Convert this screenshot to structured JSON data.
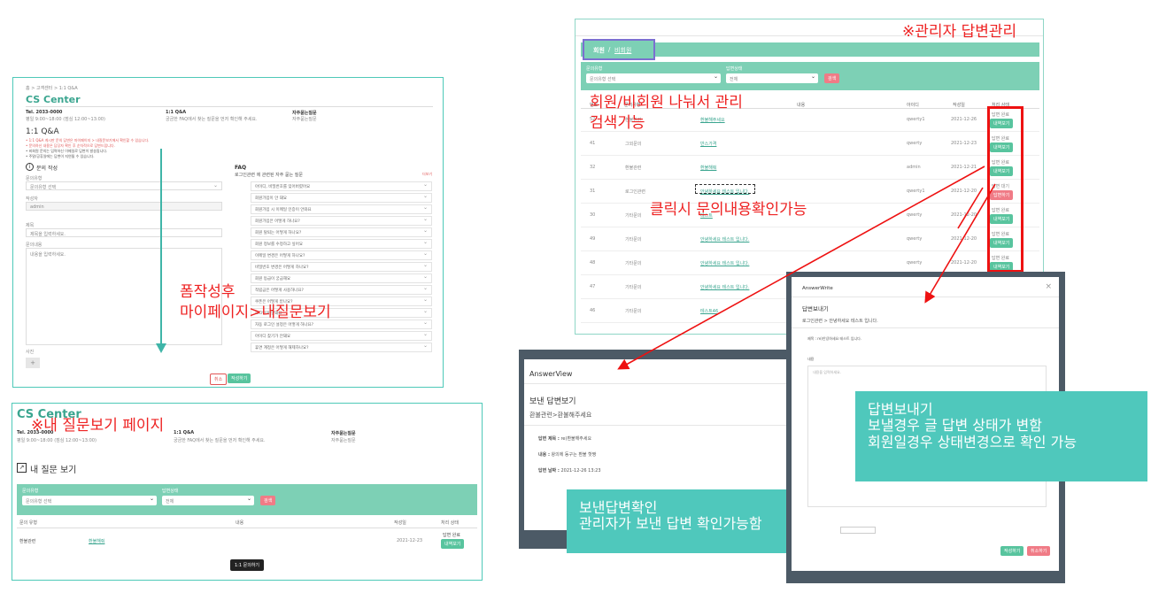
{
  "annotations": {
    "form_back": "폼작성후",
    "form_nav": "마이페이지>내질문보기",
    "my_questions": "※내 질문보기 페이지",
    "admin": "※관리자 답변관리",
    "split_members": "회원/비회원 나눠서 관리",
    "search": "검색기능",
    "click_view": "클릭시 문의내용확인가능",
    "view_box_1": "보낸답변확인",
    "view_box_2": "관리자가 보낸 답변 확인가능함",
    "send_box_1": "답변보내기",
    "send_box_2": "보낼경우 글  답변 상태가 변함",
    "send_box_3": "회원일경우 상태변경으로 확인 가능"
  },
  "qa_form": {
    "breadcrumb": "홈 > 고객센터 > 1:1 Q&A",
    "title": "CS Center",
    "tel": "Tel. 2033-0000",
    "hours": "평일 9:00~18:00 (점심 12:00~13:00)",
    "qna_label": "1:1 Q&A",
    "qna_desc": "궁금한 FAQ에서 찾는 질문을 먼저 확인해 주세요.",
    "faq_label": "자주묻는질문",
    "faq_desc": "자주묻는질문",
    "heading": "1:1 Q&A",
    "notices": [
      "• 1:1 Q&A 게시판 문의 답변은 마이페이지 > 내질문보기에서 확인할 수 있습니다.",
      "• 문의하신 내용은 담당자 확인 후 순차적으로 답변드립니다.",
      "• 비회원 문의는 입력하신 이메일로 답변이 발송됩니다.",
      "• 주말/공휴일에는 답변이 지연될 수 있습니다."
    ],
    "section": "문의 작성",
    "type_label": "문의유형",
    "type_value": "문의유형 선택",
    "writer_label": "작성자",
    "writer_value": "admin",
    "title_label": "제목",
    "title_placeholder": "제목을 입력하세요.",
    "content_label": "문의내용",
    "content_placeholder": "내용을 입력하세요.",
    "attach_label": "사진",
    "cancel": "취소",
    "submit": "작성하기",
    "faq_title": "FAQ",
    "faq_sub": "로그인관련 에 관련된 자주 묻는 질문",
    "faq_more": "더보기",
    "faq_items": [
      "아이디, 비밀번호를 잊어버렸어요",
      "회원가입이 안 돼요",
      "회원가입 시 이메일 인증이 안와요",
      "회원가입은 어떻게 하나요?",
      "회원 탈퇴는 어떻게 하나요?",
      "회원 정보를 수정하고 싶어요",
      "이메일 변경은 어떻게 하나요?",
      "비밀번호 변경은 어떻게 하나요?",
      "회원 등급이 궁금해요",
      "적립금은 어떻게 사용하나요?",
      "쿠폰은 어떻게 받나요?",
      "로그인이 안돼요",
      "자동 로그인 설정은 어떻게 하나요?",
      "아이디 찾기가 안돼요",
      "휴면 계정은 어떻게 해제하나요?"
    ]
  },
  "my_q": {
    "title": "CS Center",
    "tel": "Tel. 2033-0000",
    "hours": "평일 9:00~18:00 (점심 12:00~13:00)",
    "qna_label": "1:1 Q&A",
    "qna_desc": "궁금한 FAQ에서 찾는 질문을 먼저 확인해 주세요.",
    "faq_label": "자주묻는질문",
    "faq_desc": "자주묻는질문",
    "heading": "내 질문 보기",
    "filter_type_label": "문의유형",
    "filter_type_value": "문의유형 선택",
    "filter_status_label": "답변상태",
    "filter_status_value": "전체",
    "search": "검색",
    "cols": [
      "문의 유형",
      "내용",
      "작성일",
      "처리 상태"
    ],
    "row": {
      "type": "환불관련",
      "content": "환불해줘",
      "date": "2021-12-23",
      "status": "답변 완료",
      "btn": "내역보기"
    },
    "write_btn": "1:1 문의하기"
  },
  "admin": {
    "tabs_member": "회원",
    "tabs_sep": "/",
    "tabs_guest": "비회원",
    "filter_type_label": "문의유형",
    "filter_type_value": "문의유형 선택",
    "filter_status_label": "답변상태",
    "filter_status_value": "전체",
    "search": "검색",
    "cols": [
      "번호",
      "문의유형",
      "내용",
      "아이디",
      "작성일",
      "처리 상태"
    ],
    "rows": [
      {
        "no": "52",
        "type": "환불관련",
        "content": "환불해주세요",
        "id": "qwerty1",
        "date": "2021-12-26",
        "status": "답변 완료",
        "btn": "내역보기",
        "state": "done"
      },
      {
        "no": "41",
        "type": "그외문의",
        "content": "반스가격",
        "id": "qwerty",
        "date": "2021-12-23",
        "status": "답변 완료",
        "btn": "내역보기",
        "state": "done"
      },
      {
        "no": "32",
        "type": "환불관련",
        "content": "환불해줘",
        "id": "admin",
        "date": "2021-12-21",
        "status": "답변 완료",
        "btn": "내역보기",
        "state": "done"
      },
      {
        "no": "31",
        "type": "로그인관련",
        "content": "안녕하세요 테스트 입니다.",
        "id": "qwerty1",
        "date": "2021-12-20",
        "status": "답변 대기",
        "btn": "답변하기",
        "state": "wait"
      },
      {
        "no": "30",
        "type": "기타문의",
        "content": "테스트",
        "id": "qwerty",
        "date": "2021-12-20",
        "status": "답변 완료",
        "btn": "내역보기",
        "state": "done"
      },
      {
        "no": "49",
        "type": "기타문의",
        "content": "안녕하세요 테스트 입니다.",
        "id": "qwerty",
        "date": "2021-12-20",
        "status": "답변 완료",
        "btn": "내역보기",
        "state": "done"
      },
      {
        "no": "48",
        "type": "기타문의",
        "content": "안녕하세요 테스트 입니다.",
        "id": "qwerty",
        "date": "2021-12-20",
        "status": "답변 완료",
        "btn": "내역보기",
        "state": "done"
      },
      {
        "no": "47",
        "type": "기타문의",
        "content": "안녕하세요 테스트 입니다.",
        "id": "",
        "date": "",
        "status": "",
        "btn": "",
        "state": ""
      },
      {
        "no": "46",
        "type": "기타문의",
        "content": "테스트46",
        "id": "",
        "date": "",
        "status": "",
        "btn": "",
        "state": ""
      }
    ]
  },
  "answer_view": {
    "window_title": "AnswerView",
    "heading": "보낸 답변보기",
    "subject": "환불관련>환불해주세요",
    "answer_title_label": "답변 제목 :",
    "answer_title_value": "re)환불해주세요",
    "content_label": "내용 :",
    "content_value": "왕의에 동구는 환불 핫짱",
    "date_label": "답변 날짜 :",
    "date_value": "2021-12-26 13:23"
  },
  "answer_write": {
    "window_title": "AnswerWrite",
    "close": "×",
    "heading": "답변보내기",
    "subject": "로그인관련 > 안녕하세요 테스트 입니다.",
    "title_label": "제목 :",
    "title_value": "re)안녕하세요 테스트 입니다.",
    "content_label": "내용",
    "content_placeholder": "내용을 입력하세요.",
    "submit": "작성하기",
    "cancel": "취소하기"
  }
}
